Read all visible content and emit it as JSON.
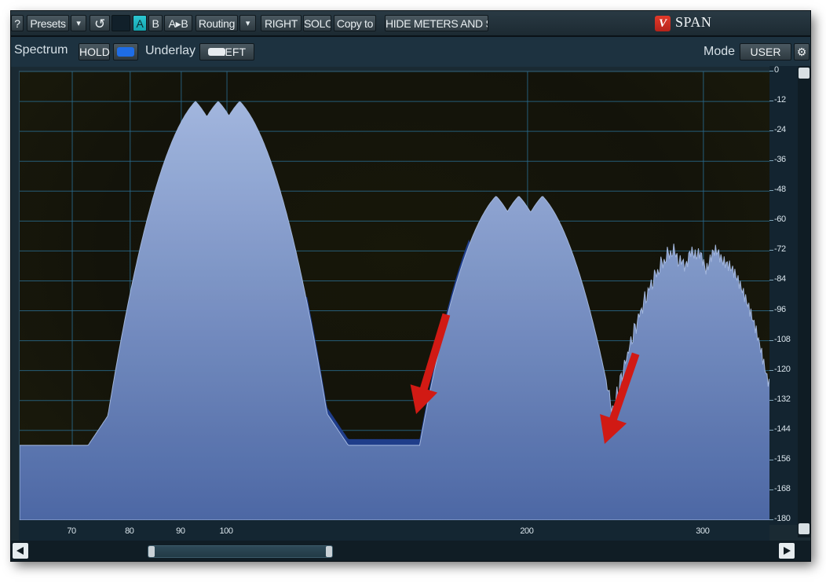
{
  "toolbar": {
    "help_label": "?",
    "presets_label": "Presets",
    "presets_menu_label": "▾",
    "undo_label": "↺",
    "a_label": "A",
    "b_label": "B",
    "a_to_b_label": "A▸B",
    "routing_label": "Routing",
    "routing_menu_label": "▾",
    "right_label": "RIGHT",
    "solo_label": "SOLO",
    "copy_to_label": "Copy to",
    "hide_meters_label": "HIDE METERS AND STATS",
    "brand_mark": "V",
    "brand_name": "SPAN"
  },
  "subbar": {
    "spectrum_label": "Spectrum",
    "hold_label": "HOLD",
    "underlay_label": "Underlay",
    "left_label": "LEFT",
    "mode_label": "Mode",
    "mode_value": "USER"
  },
  "colors": {
    "spectrum_fill": "#7b95c6",
    "spectrum_outline": "#a9bde3",
    "underlay_shadow": "#1f3d8a",
    "grid_line": "#2a6f94",
    "arrow": "#d11a14",
    "accent_teal": "#21b6c0"
  },
  "chart_data": {
    "type": "area",
    "xscale": "log",
    "x_ticks": [
      "70",
      "80",
      "90",
      "100",
      "200",
      "300"
    ],
    "y_ticks": [
      "0",
      "-12",
      "-24",
      "-36",
      "-48",
      "-60",
      "-72",
      "-84",
      "-96",
      "-108",
      "-120",
      "-132",
      "-144",
      "-156",
      "-168",
      "-180"
    ],
    "xlim": [
      62,
      350
    ],
    "ylim": [
      -180,
      0
    ],
    "peak_groups": [
      {
        "peaks_hz": [
          93,
          98,
          103
        ],
        "peak_db": -12
      },
      {
        "peaks_hz": [
          186,
          196,
          207
        ],
        "peak_db": -50
      },
      {
        "peaks_hz": [
          279,
          294,
          310
        ],
        "peak_db": -72
      }
    ],
    "arrows": 2
  }
}
